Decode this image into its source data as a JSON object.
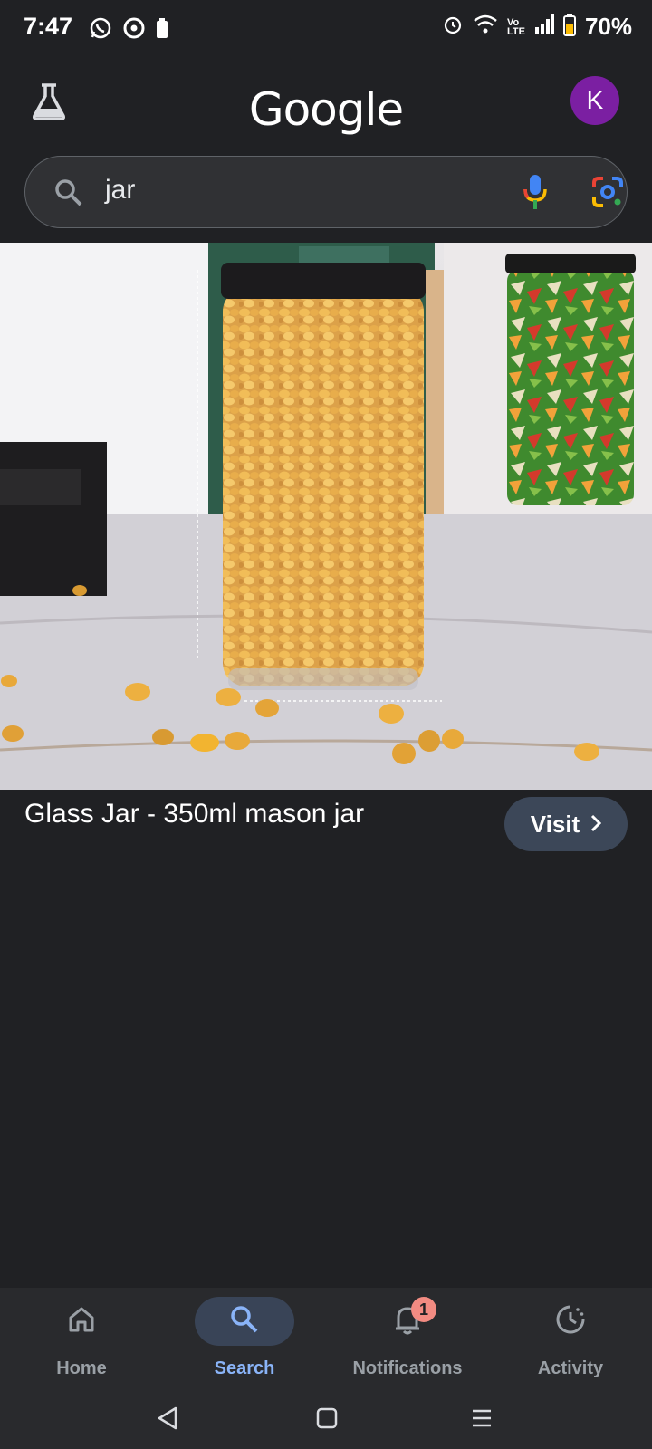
{
  "status_bar": {
    "time": "7:47",
    "battery": "70%",
    "icons": [
      "whatsapp-icon",
      "chrome-icon",
      "battery-saver-icon",
      "alarm-icon",
      "wifi-icon",
      "volte-icon",
      "signal-icon",
      "battery-icon"
    ]
  },
  "header": {
    "logo": "Google",
    "avatar_letter": "K",
    "colors": {
      "avatar": "#7b1fa2"
    }
  },
  "search": {
    "query": "jar"
  },
  "result": {
    "title": "Glass Jar - 350ml mason jar",
    "visit_label": "Visit"
  },
  "bottom_nav": {
    "items": [
      {
        "label": "Home",
        "icon": "home-icon"
      },
      {
        "label": "Search",
        "icon": "search-icon",
        "active": true
      },
      {
        "label": "Notifications",
        "icon": "bell-icon",
        "badge": "1"
      },
      {
        "label": "Activity",
        "icon": "activity-icon"
      }
    ]
  },
  "colors": {
    "background": "#202124",
    "accent": "#8ab4f8",
    "visit_button": "#3c4758"
  }
}
